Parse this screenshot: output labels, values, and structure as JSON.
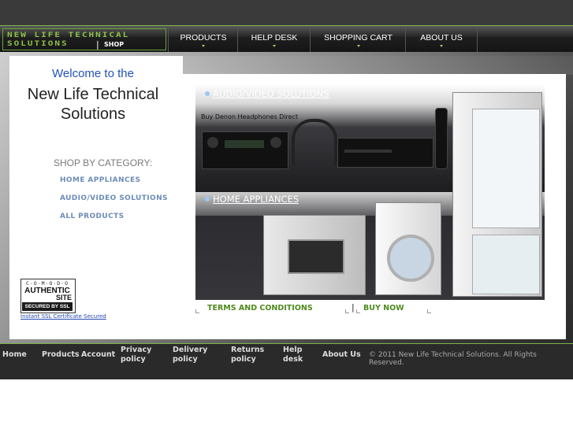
{
  "header": {
    "logo_line1": "NEW LIFE TECHNICAL",
    "logo_line2": "SOLUTIONS",
    "logo_sep": "|",
    "logo_shop": "SHOP",
    "nav": [
      "PRODUCTS",
      "HELP DESK",
      "SHOPPING CART",
      "ABOUT US"
    ]
  },
  "sidebar": {
    "welcome": "Welcome to the",
    "company_line1": "New Life Technical",
    "company_line2": "Solutions",
    "shop_by": "SHOP BY CATEGORY:",
    "categories": [
      "HOME APPLIANCES",
      "AUDIO/VIDEO SOLUTIONS",
      "ALL PRODUCTS"
    ],
    "badge": {
      "line1": "C·O·M·O·D·O",
      "line2": "AUTHENTIC",
      "line3": "SITE",
      "line4": "SECURED BY SSL"
    },
    "ssl_link": "Instant SSL Certificate Secured"
  },
  "banner": {
    "audio_link": "AUDIO/VIDEO SOLUTIONS",
    "denon_text": "Buy Denon Headphones Direct",
    "home_link": "HOME APPLIANCES"
  },
  "links": {
    "terms": "TERMS AND CONDITIONS",
    "buy_now": "BUY NOW",
    "divider": "|"
  },
  "footer": {
    "home": "Home",
    "products": "Products",
    "account": "Account",
    "privacy_1": "Privacy",
    "privacy_2": "policy",
    "delivery_1": "Delivery",
    "delivery_2": "policy",
    "returns_1": "Returns",
    "returns_2": "policy",
    "help_1": "Help",
    "help_2": "desk",
    "about": "About Us",
    "copyright": "© 2011 New Life Technical Solutions. All Rights Reserved."
  },
  "colors": {
    "accent_green": "#7fb24a",
    "link_blue": "#2152b8",
    "category_blue": "#6c8cb8",
    "action_green": "#4f8a1e"
  }
}
